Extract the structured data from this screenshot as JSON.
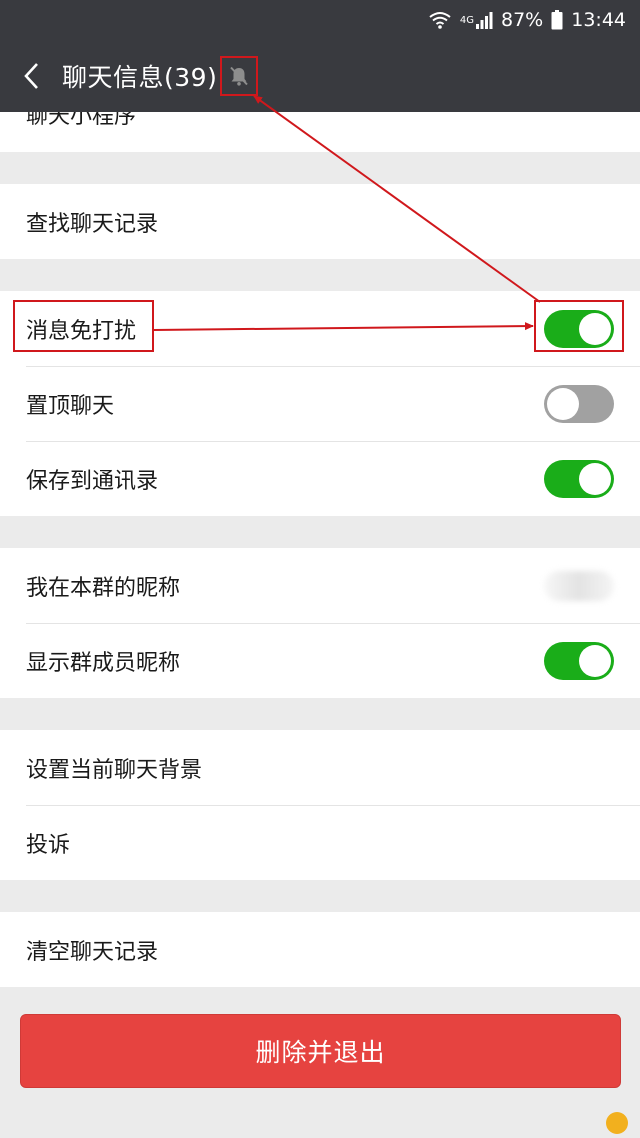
{
  "status_bar": {
    "network_label": "4G",
    "battery": "87%",
    "time": "13:44",
    "icons": [
      "wifi-icon",
      "signal-icon",
      "battery-icon"
    ]
  },
  "nav": {
    "back_icon": "chevron-left-icon",
    "title": "聊天信息(39)",
    "mute_icon": "bell-muted-icon"
  },
  "groups": [
    {
      "rows": [
        {
          "label": "聊天小程序"
        }
      ]
    },
    {
      "rows": [
        {
          "label": "查找聊天记录"
        }
      ]
    },
    {
      "rows": [
        {
          "label": "消息免打扰",
          "toggle": "on"
        },
        {
          "label": "置顶聊天",
          "toggle": "off"
        },
        {
          "label": "保存到通讯录",
          "toggle": "on"
        }
      ]
    },
    {
      "rows": [
        {
          "label": "我在本群的昵称"
        },
        {
          "label": "显示群成员昵称",
          "toggle": "on"
        }
      ]
    },
    {
      "rows": [
        {
          "label": "设置当前聊天背景"
        },
        {
          "label": "投诉"
        }
      ]
    },
    {
      "rows": [
        {
          "label": "清空聊天记录"
        }
      ]
    }
  ],
  "delete_button": "删除并退出",
  "colors": {
    "header": "#393a3f",
    "toggle_on": "#1aad19",
    "toggle_off": "#a1a1a1",
    "danger": "#e64340",
    "annotation": "#d0181c"
  }
}
